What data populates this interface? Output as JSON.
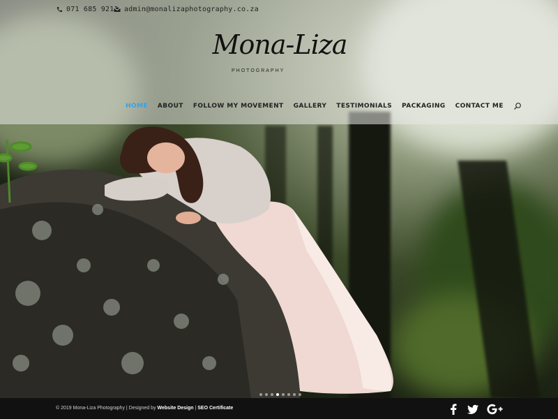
{
  "header": {
    "phone": "071 685 9213",
    "email": "admin@monalizaphotography.co.za",
    "logo": {
      "title": "Mona-Liza",
      "subtitle": "PHOTOGRAPHY"
    },
    "nav": [
      {
        "label": "HOME",
        "active": true
      },
      {
        "label": "ABOUT",
        "active": false
      },
      {
        "label": "FOLLOW MY MOVEMENT",
        "active": false
      },
      {
        "label": "GALLERY",
        "active": false
      },
      {
        "label": "TESTIMONIALS",
        "active": false
      },
      {
        "label": "PACKAGING",
        "active": false
      },
      {
        "label": "CONTACT ME",
        "active": false
      }
    ]
  },
  "slider": {
    "dot_count": 8,
    "active_index": 3
  },
  "footer": {
    "copyright": "© 2019 Mona-Liza Photography | Designed by",
    "designer_link": "Website Design",
    "separator": "|",
    "seo_link": "SEO Certificate",
    "social": [
      "facebook-icon",
      "twitter-icon",
      "google-plus-icon"
    ]
  },
  "colors": {
    "accent": "#2ea3f2",
    "footer_bg": "#111111"
  }
}
